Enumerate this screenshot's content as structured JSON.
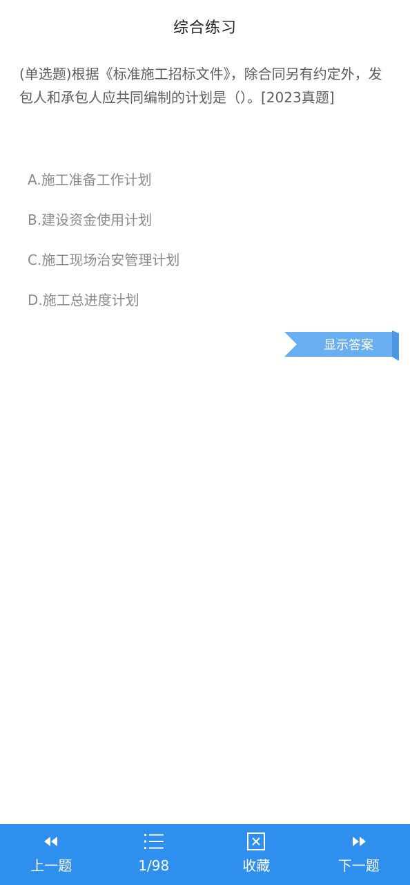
{
  "header": {
    "title": "综合练习"
  },
  "question": {
    "text": "(单选题)根据《标准施工招标文件》，除合同另有约定外，发包人和承包人应共同编制的计划是（）。[2023真题]"
  },
  "options": [
    {
      "label": "A.施工准备工作计划"
    },
    {
      "label": "B.建设资金使用计划"
    },
    {
      "label": "C.施工现场治安管理计划"
    },
    {
      "label": "D.施工总进度计划"
    }
  ],
  "show_answer": {
    "label": "显示答案"
  },
  "bottom_nav": {
    "prev": {
      "label": "上一题",
      "icon": "rewind-icon"
    },
    "progress": {
      "label": "1/98",
      "icon": "list-icon"
    },
    "favorite": {
      "label": "收藏",
      "icon": "bookmark-box-icon"
    },
    "next": {
      "label": "下一题",
      "icon": "fast-forward-icon"
    }
  },
  "colors": {
    "nav_bar": "#2e8fee",
    "answer_ribbon": "#6aaef2",
    "question_text": "#5c5c5c",
    "option_text": "#8a8a8a"
  }
}
